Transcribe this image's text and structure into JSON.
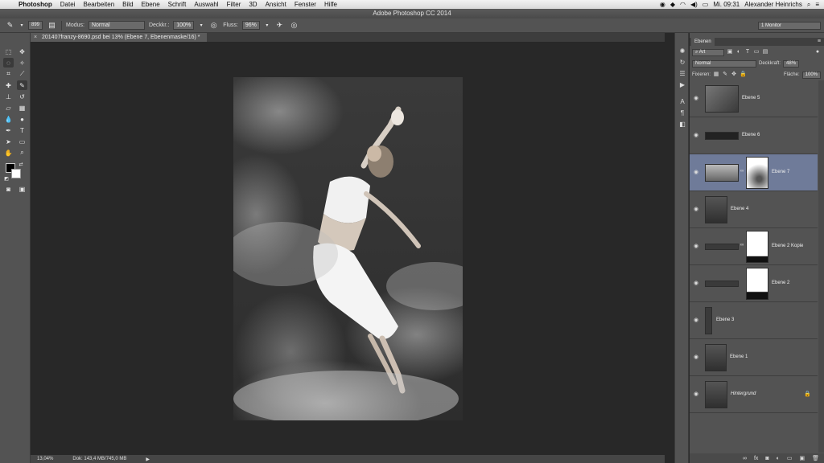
{
  "menubar": {
    "apple": "",
    "items": [
      "Photoshop",
      "Datei",
      "Bearbeiten",
      "Bild",
      "Ebene",
      "Schrift",
      "Auswahl",
      "Filter",
      "3D",
      "Ansicht",
      "Fenster",
      "Hilfe"
    ],
    "clock": "Mi. 09:31",
    "user": "Alexander Heinrichs"
  },
  "window": {
    "title": "Adobe Photoshop CC 2014"
  },
  "options": {
    "brush_size": "899",
    "mode_label": "Modus:",
    "mode_value": "Normal",
    "opacity_label": "Deckkr.:",
    "opacity_value": "100%",
    "flow_label": "Fluss:",
    "flow_value": "96%",
    "workspace": "1 Monitor"
  },
  "document": {
    "tab_title": "201407franzy-8690.psd bei 13% (Ebene 7, Ebenenmaske/16) *",
    "close": "×"
  },
  "status": {
    "zoom": "13,04%",
    "doc_size": "Dok: 143,4 MB/745,0 MB",
    "arrow": "▶"
  },
  "panel": {
    "tab": "Ebenen",
    "filter_kind": "Art",
    "blend_mode": "Normal",
    "opacity_label": "Deckkraft:",
    "opacity_value": "48%",
    "lock_label": "Fixieren:",
    "fill_label": "Fläche:",
    "fill_value": "100%"
  },
  "layers": [
    {
      "name": "Ebene 5",
      "selected": false,
      "has_mask": false,
      "italic": false
    },
    {
      "name": "Ebene 6",
      "selected": false,
      "has_mask": false,
      "italic": false
    },
    {
      "name": "Ebene 7",
      "selected": true,
      "has_mask": true,
      "italic": false
    },
    {
      "name": "Ebene 4",
      "selected": false,
      "has_mask": false,
      "italic": false
    },
    {
      "name": "Ebene 2 Kopie",
      "selected": false,
      "has_mask": true,
      "italic": false
    },
    {
      "name": "Ebene 2",
      "selected": false,
      "has_mask": true,
      "italic": false
    },
    {
      "name": "Ebene 3",
      "selected": false,
      "has_mask": false,
      "italic": false
    },
    {
      "name": "Ebene 1",
      "selected": false,
      "has_mask": false,
      "italic": false
    },
    {
      "name": "Hintergrund",
      "selected": false,
      "has_mask": false,
      "italic": true
    }
  ],
  "colors": {
    "selection": "#6f7b99",
    "panel_bg": "#535353",
    "canvas_bg": "#282828"
  }
}
